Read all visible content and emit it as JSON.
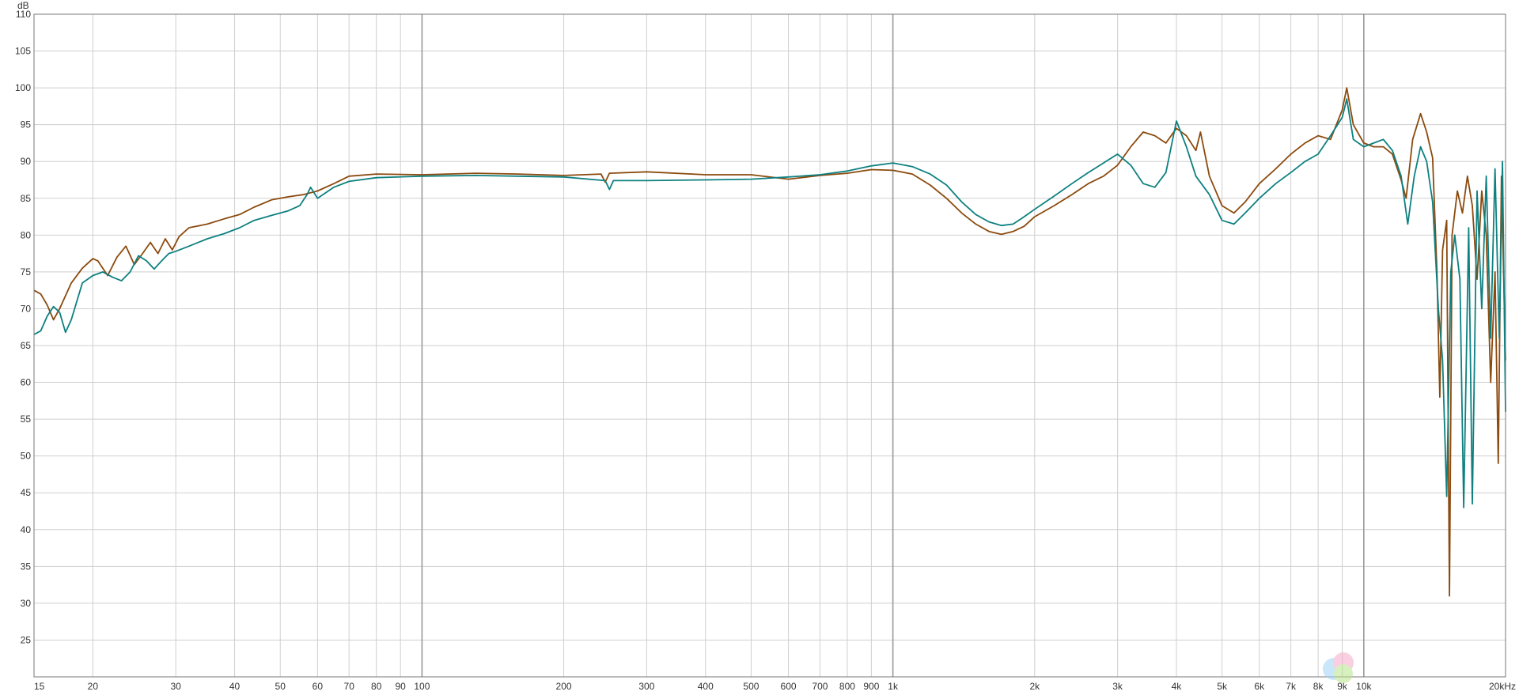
{
  "chart_data": {
    "type": "line",
    "x_scale": "log",
    "y_unit_label": "dB",
    "xlim": [
      15,
      20000
    ],
    "ylim": [
      20,
      110
    ],
    "grid": true,
    "y_ticks": [
      25,
      30,
      35,
      40,
      45,
      50,
      55,
      60,
      65,
      70,
      75,
      80,
      85,
      90,
      95,
      100,
      105,
      110
    ],
    "x_ticks": [
      {
        "value": 15,
        "label": "15"
      },
      {
        "value": 20,
        "label": "20"
      },
      {
        "value": 30,
        "label": "30"
      },
      {
        "value": 40,
        "label": "40"
      },
      {
        "value": 50,
        "label": "50"
      },
      {
        "value": 60,
        "label": "60"
      },
      {
        "value": 70,
        "label": "70"
      },
      {
        "value": 80,
        "label": "80"
      },
      {
        "value": 90,
        "label": "90"
      },
      {
        "value": 100,
        "label": "100"
      },
      {
        "value": 200,
        "label": "200"
      },
      {
        "value": 300,
        "label": "300"
      },
      {
        "value": 400,
        "label": "400"
      },
      {
        "value": 500,
        "label": "500"
      },
      {
        "value": 600,
        "label": "600"
      },
      {
        "value": 700,
        "label": "700"
      },
      {
        "value": 800,
        "label": "800"
      },
      {
        "value": 900,
        "label": "900"
      },
      {
        "value": 1000,
        "label": "1k"
      },
      {
        "value": 2000,
        "label": "2k"
      },
      {
        "value": 3000,
        "label": "3k"
      },
      {
        "value": 4000,
        "label": "4k"
      },
      {
        "value": 5000,
        "label": "5k"
      },
      {
        "value": 6000,
        "label": "6k"
      },
      {
        "value": 7000,
        "label": "7k"
      },
      {
        "value": 8000,
        "label": "8k"
      },
      {
        "value": 9000,
        "label": "9k"
      },
      {
        "value": 10000,
        "label": "10k"
      },
      {
        "value": 20000,
        "label": "20kHz"
      }
    ],
    "series": [
      {
        "color": "#8B4A0E",
        "points": [
          [
            15,
            72.5
          ],
          [
            15.5,
            72.0
          ],
          [
            16,
            70.5
          ],
          [
            16.5,
            68.5
          ],
          [
            17,
            70.0
          ],
          [
            18,
            73.5
          ],
          [
            19,
            75.5
          ],
          [
            20,
            76.8
          ],
          [
            20.5,
            76.5
          ],
          [
            21.5,
            74.5
          ],
          [
            22.5,
            77.0
          ],
          [
            23.5,
            78.5
          ],
          [
            24.5,
            76.0
          ],
          [
            25.5,
            77.5
          ],
          [
            26.5,
            79.0
          ],
          [
            27.5,
            77.5
          ],
          [
            28.5,
            79.5
          ],
          [
            29.5,
            78.0
          ],
          [
            30.5,
            79.8
          ],
          [
            32,
            81.0
          ],
          [
            35,
            81.5
          ],
          [
            38,
            82.2
          ],
          [
            41,
            82.8
          ],
          [
            44,
            83.8
          ],
          [
            48,
            84.8
          ],
          [
            52,
            85.2
          ],
          [
            56,
            85.5
          ],
          [
            60,
            86.0
          ],
          [
            65,
            87.0
          ],
          [
            70,
            88.0
          ],
          [
            80,
            88.3
          ],
          [
            100,
            88.2
          ],
          [
            130,
            88.4
          ],
          [
            160,
            88.3
          ],
          [
            200,
            88.1
          ],
          [
            240,
            88.3
          ],
          [
            245,
            87.2
          ],
          [
            250,
            88.4
          ],
          [
            300,
            88.6
          ],
          [
            400,
            88.2
          ],
          [
            500,
            88.2
          ],
          [
            600,
            87.6
          ],
          [
            700,
            88.1
          ],
          [
            800,
            88.4
          ],
          [
            900,
            88.9
          ],
          [
            1000,
            88.8
          ],
          [
            1100,
            88.3
          ],
          [
            1200,
            86.8
          ],
          [
            1300,
            85.0
          ],
          [
            1400,
            83.0
          ],
          [
            1500,
            81.5
          ],
          [
            1600,
            80.5
          ],
          [
            1700,
            80.1
          ],
          [
            1800,
            80.5
          ],
          [
            1900,
            81.2
          ],
          [
            2000,
            82.5
          ],
          [
            2200,
            84.0
          ],
          [
            2400,
            85.5
          ],
          [
            2600,
            87.0
          ],
          [
            2800,
            88.0
          ],
          [
            3000,
            89.5
          ],
          [
            3200,
            92.0
          ],
          [
            3400,
            94.0
          ],
          [
            3600,
            93.5
          ],
          [
            3800,
            92.5
          ],
          [
            4000,
            94.5
          ],
          [
            4200,
            93.5
          ],
          [
            4400,
            91.5
          ],
          [
            4500,
            94.0
          ],
          [
            4700,
            88.0
          ],
          [
            5000,
            84.0
          ],
          [
            5300,
            83.0
          ],
          [
            5600,
            84.5
          ],
          [
            6000,
            87.0
          ],
          [
            6500,
            89.0
          ],
          [
            7000,
            91.0
          ],
          [
            7500,
            92.5
          ],
          [
            8000,
            93.5
          ],
          [
            8500,
            93.0
          ],
          [
            9000,
            97.0
          ],
          [
            9200,
            100.0
          ],
          [
            9500,
            95.0
          ],
          [
            10000,
            92.5
          ],
          [
            10500,
            92.0
          ],
          [
            11000,
            92.0
          ],
          [
            11500,
            91.0
          ],
          [
            12000,
            87.5
          ],
          [
            12300,
            85.0
          ],
          [
            12700,
            93.0
          ],
          [
            13200,
            96.5
          ],
          [
            13600,
            94.0
          ],
          [
            14000,
            90.5
          ],
          [
            14300,
            75.0
          ],
          [
            14500,
            58.0
          ],
          [
            14700,
            78.0
          ],
          [
            15000,
            82.0
          ],
          [
            15200,
            31.0
          ],
          [
            15400,
            80.0
          ],
          [
            15800,
            86.0
          ],
          [
            16200,
            83.0
          ],
          [
            16600,
            88.0
          ],
          [
            17000,
            84.0
          ],
          [
            17400,
            74.0
          ],
          [
            17800,
            86.0
          ],
          [
            18200,
            80.0
          ],
          [
            18600,
            60.0
          ],
          [
            19000,
            75.0
          ],
          [
            19300,
            49.0
          ],
          [
            19600,
            88.0
          ],
          [
            20000,
            63.0
          ]
        ]
      },
      {
        "color": "#0E8080",
        "points": [
          [
            15,
            66.5
          ],
          [
            15.5,
            67.0
          ],
          [
            16,
            69.0
          ],
          [
            16.5,
            70.3
          ],
          [
            17,
            69.5
          ],
          [
            17.5,
            66.8
          ],
          [
            18,
            68.5
          ],
          [
            19,
            73.5
          ],
          [
            20,
            74.5
          ],
          [
            21,
            75.0
          ],
          [
            22,
            74.3
          ],
          [
            23,
            73.8
          ],
          [
            24,
            75.0
          ],
          [
            25,
            77.2
          ],
          [
            26,
            76.5
          ],
          [
            27,
            75.4
          ],
          [
            28,
            76.5
          ],
          [
            29,
            77.5
          ],
          [
            30,
            77.8
          ],
          [
            32,
            78.5
          ],
          [
            35,
            79.5
          ],
          [
            38,
            80.2
          ],
          [
            41,
            81.0
          ],
          [
            44,
            82.0
          ],
          [
            48,
            82.7
          ],
          [
            52,
            83.3
          ],
          [
            55,
            84.0
          ],
          [
            57,
            85.5
          ],
          [
            58,
            86.5
          ],
          [
            60,
            85.0
          ],
          [
            65,
            86.5
          ],
          [
            70,
            87.3
          ],
          [
            80,
            87.8
          ],
          [
            100,
            88.0
          ],
          [
            130,
            88.1
          ],
          [
            160,
            88.0
          ],
          [
            200,
            87.9
          ],
          [
            245,
            87.4
          ],
          [
            250,
            86.2
          ],
          [
            255,
            87.4
          ],
          [
            300,
            87.4
          ],
          [
            400,
            87.5
          ],
          [
            500,
            87.6
          ],
          [
            600,
            87.9
          ],
          [
            700,
            88.2
          ],
          [
            800,
            88.7
          ],
          [
            900,
            89.4
          ],
          [
            1000,
            89.8
          ],
          [
            1100,
            89.3
          ],
          [
            1200,
            88.3
          ],
          [
            1300,
            86.8
          ],
          [
            1400,
            84.5
          ],
          [
            1500,
            82.8
          ],
          [
            1600,
            81.8
          ],
          [
            1700,
            81.3
          ],
          [
            1800,
            81.5
          ],
          [
            1900,
            82.5
          ],
          [
            2000,
            83.5
          ],
          [
            2200,
            85.3
          ],
          [
            2400,
            87.0
          ],
          [
            2600,
            88.5
          ],
          [
            2800,
            89.8
          ],
          [
            3000,
            91.0
          ],
          [
            3200,
            89.5
          ],
          [
            3400,
            87.0
          ],
          [
            3600,
            86.5
          ],
          [
            3800,
            88.5
          ],
          [
            4000,
            95.5
          ],
          [
            4200,
            92.0
          ],
          [
            4400,
            88.0
          ],
          [
            4700,
            85.5
          ],
          [
            5000,
            82.0
          ],
          [
            5300,
            81.5
          ],
          [
            5600,
            83.0
          ],
          [
            6000,
            85.0
          ],
          [
            6500,
            87.0
          ],
          [
            7000,
            88.5
          ],
          [
            7500,
            90.0
          ],
          [
            8000,
            91.0
          ],
          [
            8500,
            93.5
          ],
          [
            9000,
            96.0
          ],
          [
            9200,
            98.5
          ],
          [
            9500,
            93.0
          ],
          [
            10000,
            92.0
          ],
          [
            10500,
            92.5
          ],
          [
            11000,
            93.0
          ],
          [
            11500,
            91.5
          ],
          [
            12000,
            88.0
          ],
          [
            12400,
            81.5
          ],
          [
            12800,
            88.0
          ],
          [
            13200,
            92.0
          ],
          [
            13600,
            90.0
          ],
          [
            14000,
            84.5
          ],
          [
            14400,
            70.0
          ],
          [
            14700,
            63.0
          ],
          [
            15000,
            44.5
          ],
          [
            15300,
            75.0
          ],
          [
            15600,
            80.0
          ],
          [
            16000,
            74.0
          ],
          [
            16300,
            43.0
          ],
          [
            16700,
            81.0
          ],
          [
            17000,
            43.5
          ],
          [
            17400,
            86.0
          ],
          [
            17800,
            70.0
          ],
          [
            18200,
            88.0
          ],
          [
            18600,
            66.0
          ],
          [
            19000,
            89.0
          ],
          [
            19400,
            66.0
          ],
          [
            19700,
            90.0
          ],
          [
            20000,
            56.0
          ]
        ]
      }
    ]
  },
  "colors": {
    "grid": "#cfcfcf",
    "axis": "#777777",
    "background": "#ffffff"
  }
}
